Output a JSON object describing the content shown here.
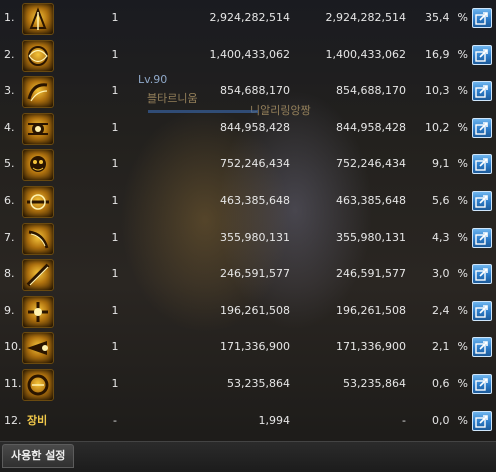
{
  "overlay": {
    "level": "Lv.90",
    "name_line1": "블타르니움",
    "name_line2": "니알리링앙짱"
  },
  "rows": [
    {
      "rank": "1.",
      "hits": "1",
      "damage": "2,924,282,514",
      "total": "2,924,282,514",
      "percent": "35,4",
      "pct_symbol": "%",
      "icon": "skill-icon-1"
    },
    {
      "rank": "2.",
      "hits": "1",
      "damage": "1,400,433,062",
      "total": "1,400,433,062",
      "percent": "16,9",
      "pct_symbol": "%",
      "icon": "skill-icon-2"
    },
    {
      "rank": "3.",
      "hits": "1",
      "damage": "854,688,170",
      "total": "854,688,170",
      "percent": "10,3",
      "pct_symbol": "%",
      "icon": "skill-icon-3"
    },
    {
      "rank": "4.",
      "hits": "1",
      "damage": "844,958,428",
      "total": "844,958,428",
      "percent": "10,2",
      "pct_symbol": "%",
      "icon": "skill-icon-4"
    },
    {
      "rank": "5.",
      "hits": "1",
      "damage": "752,246,434",
      "total": "752,246,434",
      "percent": "9,1",
      "pct_symbol": "%",
      "icon": "skill-icon-5"
    },
    {
      "rank": "6.",
      "hits": "1",
      "damage": "463,385,648",
      "total": "463,385,648",
      "percent": "5,6",
      "pct_symbol": "%",
      "icon": "skill-icon-6"
    },
    {
      "rank": "7.",
      "hits": "1",
      "damage": "355,980,131",
      "total": "355,980,131",
      "percent": "4,3",
      "pct_symbol": "%",
      "icon": "skill-icon-7"
    },
    {
      "rank": "8.",
      "hits": "1",
      "damage": "246,591,577",
      "total": "246,591,577",
      "percent": "3,0",
      "pct_symbol": "%",
      "icon": "skill-icon-8"
    },
    {
      "rank": "9.",
      "hits": "1",
      "damage": "196,261,508",
      "total": "196,261,508",
      "percent": "2,4",
      "pct_symbol": "%",
      "icon": "skill-icon-9"
    },
    {
      "rank": "10.",
      "hits": "1",
      "damage": "171,336,900",
      "total": "171,336,900",
      "percent": "2,1",
      "pct_symbol": "%",
      "icon": "skill-icon-10"
    },
    {
      "rank": "11.",
      "hits": "1",
      "damage": "53,235,864",
      "total": "53,235,864",
      "percent": "0,6",
      "pct_symbol": "%",
      "icon": "skill-icon-11"
    },
    {
      "rank": "12.",
      "label": "장비",
      "hits": "-",
      "damage": "1,994",
      "total": "-",
      "percent": "0,0",
      "pct_symbol": "%",
      "icon": ""
    }
  ],
  "footer": {
    "settings_tab": "사용한 설정"
  },
  "colors": {
    "icon_gold": "#f5c43a",
    "share_blue": "#2b7bc8",
    "equip_label": "#f0c84a"
  },
  "icons": {
    "share": "share-arrow-icon"
  }
}
